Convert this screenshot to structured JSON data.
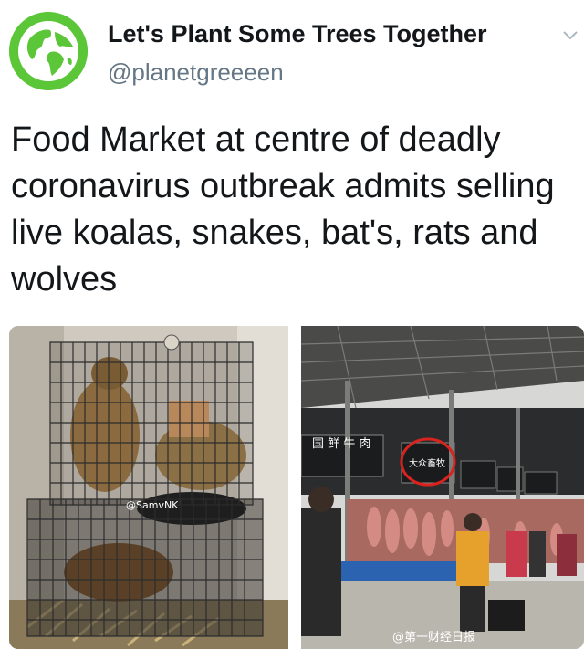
{
  "account": {
    "display_name": "Let's Plant Some Trees Together",
    "handle": "@planetgreeeen",
    "avatar_icon": "globe-icon",
    "menu_icon": "chevron-down-icon"
  },
  "tweet": {
    "text": "Food Market at centre of deadly coronavirus outbreak admits selling live koalas, snakes, bat's, rats and wolves"
  },
  "media": {
    "left": {
      "watermark": "@SamvNK"
    },
    "right": {
      "sign_left": "国 鲜 牛 肉",
      "sign_highlighted": "大众畜牧",
      "watermark": "@第一财经日报"
    }
  },
  "colors": {
    "accent_green": "#5cc639",
    "handle_gray": "#657786",
    "highlight_red": "#d8231f"
  }
}
